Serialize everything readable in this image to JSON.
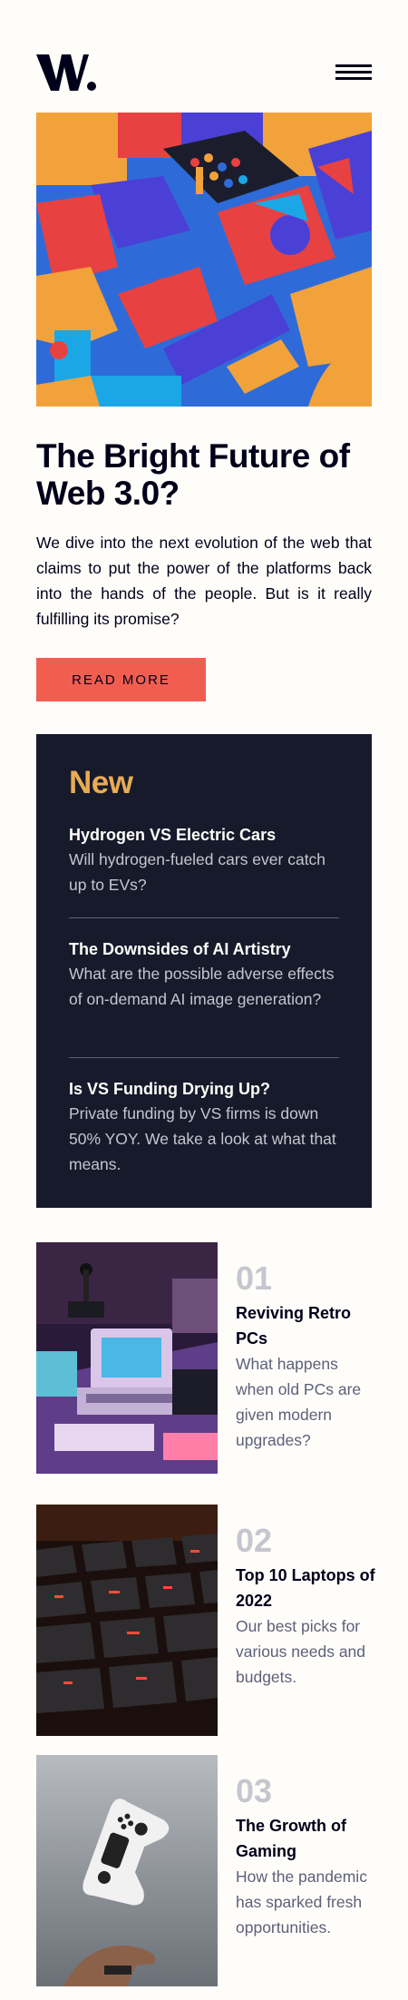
{
  "header": {
    "logo_text": "W.",
    "colors": {
      "ink": "#00001a",
      "accent": "#f15e50",
      "gold": "#e9ab53",
      "panel": "#161a2b"
    }
  },
  "hero": {
    "title": "The Bright Future of Web 3.0?",
    "description": "We dive into the next evolution of the web that claims to put the power of the platforms back into the hands of the people. But is it really fulfilling its promise?",
    "cta_label": "READ MORE"
  },
  "new_panel": {
    "title": "New",
    "items": [
      {
        "title": "Hydrogen VS Electric Cars",
        "text": "Will hydrogen-fueled cars ever catch up to EVs?"
      },
      {
        "title": "The Downsides of AI Artistry",
        "text": "What are the possible adverse effects of on-demand AI image generation?"
      },
      {
        "title": "Is VS Funding Drying Up?",
        "text": "Private funding by VS firms is down 50% YOY. We take a look at what that means."
      }
    ]
  },
  "articles": [
    {
      "number": "01",
      "title": "Reviving Retro PCs",
      "text": "What happens when old PCs are given modern upgrades?"
    },
    {
      "number": "02",
      "title": "Top 10 Laptops of 2022",
      "text": "Our best picks for various needs and budgets."
    },
    {
      "number": "03",
      "title": "The Growth of Gaming",
      "text": "How the pandemic has sparked fresh opportunities."
    }
  ]
}
